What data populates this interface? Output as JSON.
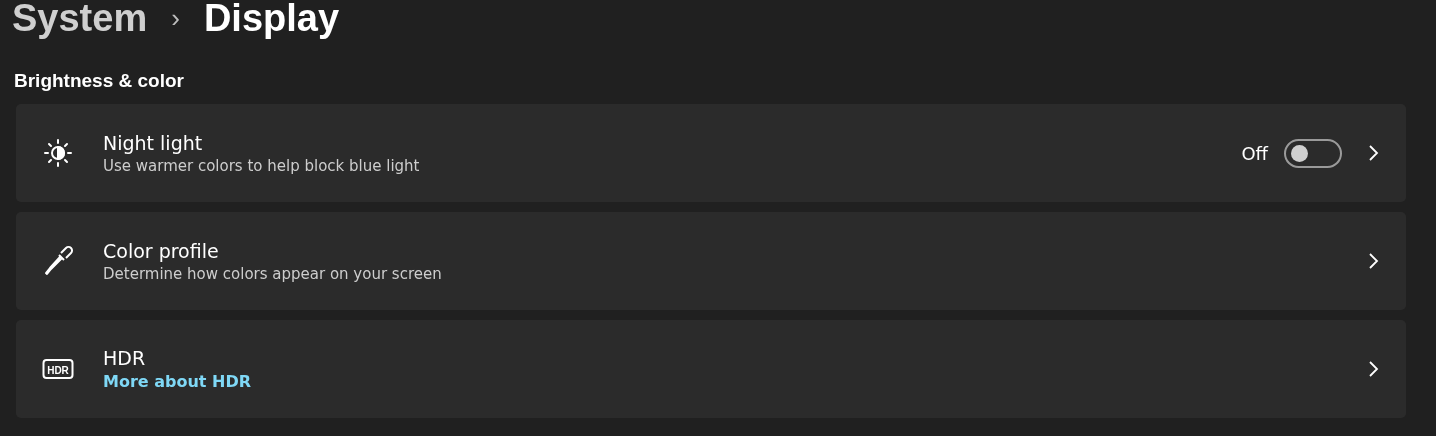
{
  "breadcrumb": {
    "parent": "System",
    "separator": "›",
    "current": "Display"
  },
  "section": {
    "title": "Brightness & color"
  },
  "settings": [
    {
      "kind": "toggle",
      "title": "Night light",
      "description": "Use warmer colors to help block blue light",
      "state_label": "Off",
      "on": false
    },
    {
      "kind": "plain",
      "title": "Color profile",
      "description": "Determine how colors appear on your screen"
    },
    {
      "kind": "link",
      "title": "HDR",
      "link": "More about HDR",
      "icon_text": "HDR"
    }
  ]
}
